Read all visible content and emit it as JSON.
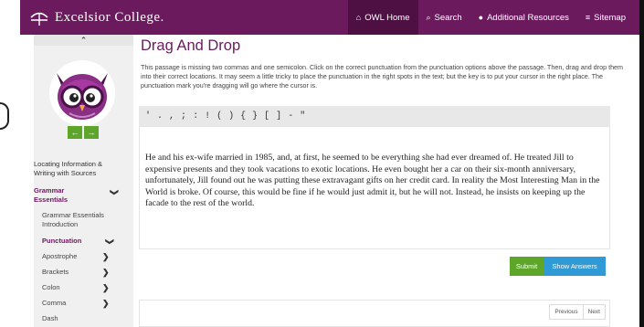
{
  "brand": {
    "name": "Excelsior College."
  },
  "nav": [
    {
      "icon": "home-icon",
      "glyph": "⌂",
      "label": "OWL Home"
    },
    {
      "icon": "search-icon",
      "glyph": "⌕",
      "label": "Search"
    },
    {
      "icon": "plus-circle-icon",
      "glyph": "●",
      "label": "Additional Resources"
    },
    {
      "icon": "list-icon",
      "glyph": "≡",
      "label": "Sitemap"
    }
  ],
  "sidebar": {
    "collapse_glyph": "⌃",
    "prev_glyph": "←",
    "next_glyph": "→",
    "items": [
      {
        "label": "Locating Information & Writing with Sources"
      },
      {
        "label": "Grammar Essentials"
      },
      {
        "label": "Grammar Essentials Introduction"
      },
      {
        "label": "Punctuation"
      },
      {
        "label": "Apostrophe"
      },
      {
        "label": "Brackets"
      },
      {
        "label": "Colon"
      },
      {
        "label": "Comma"
      },
      {
        "label": "Dash"
      }
    ],
    "chevron": "❯"
  },
  "main": {
    "title": "Drag And Drop",
    "intro": "This passage is missing two commas and one semicolon. Click on the correct punctuation from the punctuation options above the passage. Then, drag and drop them into their correct locations. It may seem a little tricky to place the punctuation in the right spots in the text; but the key is to put your cursor in the right place. The punctuation mark you're dragging will go where the cursor is.",
    "punctuation": [
      "'",
      ".",
      ",",
      ";",
      ":",
      "!",
      "(",
      ")",
      "{",
      "}",
      "[",
      "]",
      "-",
      "\""
    ],
    "passage": "He and his ex-wife married in 1985, and, at first, he seemed to be everything she had ever dreamed of. He treated Jill to expensive presents and they took vacations to exotic locations. He even bought her a car on their six-month anniversary, unfortunately, Jill found out he was putting these extravagant gifts on her credit card. In reality the Most Interesting Man in the World is broke. Of course, this would be fine if he would just admit it, but he will not. Instead, he insists on keeping up the facade to the rest of the world.",
    "submit_label": "Submit",
    "show_answers_label": "Show Answers",
    "previous_label": "Previous",
    "next_label": "Next"
  },
  "colors": {
    "brand": "#6b1a5d",
    "submit": "#5ea62a",
    "show_answers": "#2f9ad6"
  }
}
